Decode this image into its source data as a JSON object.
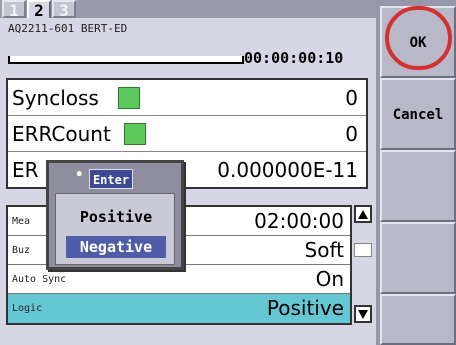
{
  "tabs": [
    "1",
    "2",
    "3"
  ],
  "device_title": "AQ2211-601 BERT-ED",
  "elapsed_time": "00:00:00:10",
  "status_rows": [
    {
      "label": "Syncloss",
      "value": "0"
    },
    {
      "label": "ERRCount",
      "value": "0"
    },
    {
      "label": "ER",
      "value": "0.000000E-11"
    }
  ],
  "settings": [
    {
      "label": "Mea",
      "value": "02:00:00"
    },
    {
      "label": "Buz",
      "value": "Soft"
    },
    {
      "label": "Auto Sync",
      "value": "On"
    },
    {
      "label": "Logic",
      "value": "Positive"
    }
  ],
  "popup": {
    "header": "Enter",
    "options": [
      "Positive",
      "Negative"
    ],
    "selected": "Negative"
  },
  "buttons": {
    "ok": "OK",
    "cancel": "Cancel"
  },
  "colors": {
    "indicator_green": "#5bc95b",
    "selection_cyan": "#66c7d4",
    "highlight_blue": "#4f5ca8",
    "annotation_red": "#d43030"
  }
}
